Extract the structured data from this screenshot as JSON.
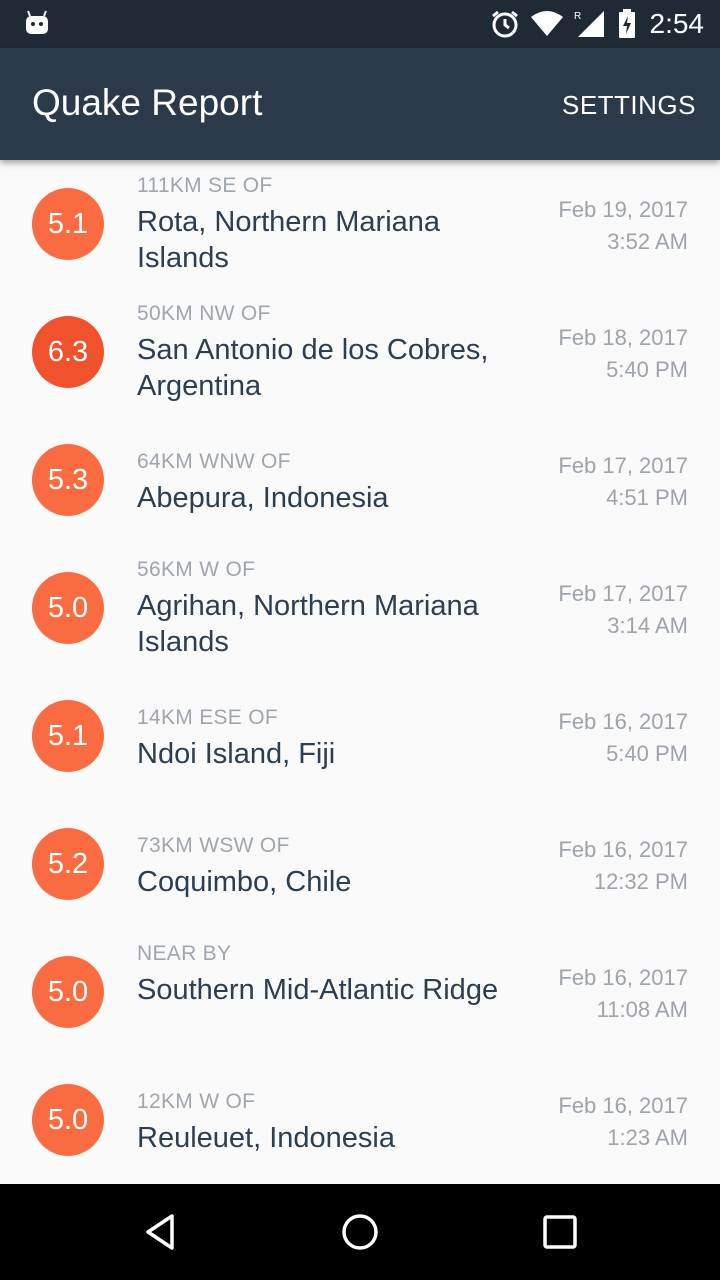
{
  "status_bar": {
    "time": "2:54",
    "icons": [
      "android-icon",
      "alarm-icon",
      "wifi-icon",
      "cell-signal-icon",
      "battery-icon"
    ]
  },
  "app_bar": {
    "title": "Quake Report",
    "settings_label": "SETTINGS"
  },
  "colors": {
    "status_bar": "#1f2a35",
    "app_bar": "#2b3a4a",
    "magnitude": "#f96c41",
    "magnitude_strong": "#f0522d"
  },
  "earthquakes": [
    {
      "magnitude": "5.1",
      "offset": "111km SE of",
      "place": "Rota, Northern Mariana Islands",
      "date": "Feb 19, 2017",
      "time": "3:52 AM"
    },
    {
      "magnitude": "6.3",
      "offset": "50km NW of",
      "place": "San Antonio de los Cobres, Argentina",
      "date": "Feb 18, 2017",
      "time": "5:40 PM"
    },
    {
      "magnitude": "5.3",
      "offset": "64km WNW of",
      "place": "Abepura, Indonesia",
      "date": "Feb 17, 2017",
      "time": "4:51 PM"
    },
    {
      "magnitude": "5.0",
      "offset": "56km W of",
      "place": "Agrihan, Northern Mariana Islands",
      "date": "Feb 17, 2017",
      "time": "3:14 AM"
    },
    {
      "magnitude": "5.1",
      "offset": "14km ESE of",
      "place": "Ndoi Island, Fiji",
      "date": "Feb 16, 2017",
      "time": "5:40 PM"
    },
    {
      "magnitude": "5.2",
      "offset": "73km WSW of",
      "place": "Coquimbo, Chile",
      "date": "Feb 16, 2017",
      "time": "12:32 PM"
    },
    {
      "magnitude": "5.0",
      "offset": "Near by",
      "place": "Southern Mid-Atlantic Ridge",
      "date": "Feb 16, 2017",
      "time": "11:08 AM"
    },
    {
      "magnitude": "5.0",
      "offset": "12km W of",
      "place": "Reuleuet, Indonesia",
      "date": "Feb 16, 2017",
      "time": "1:23 AM"
    }
  ],
  "nav_bar": {
    "icons": [
      "back-icon",
      "home-icon",
      "recents-icon"
    ]
  }
}
